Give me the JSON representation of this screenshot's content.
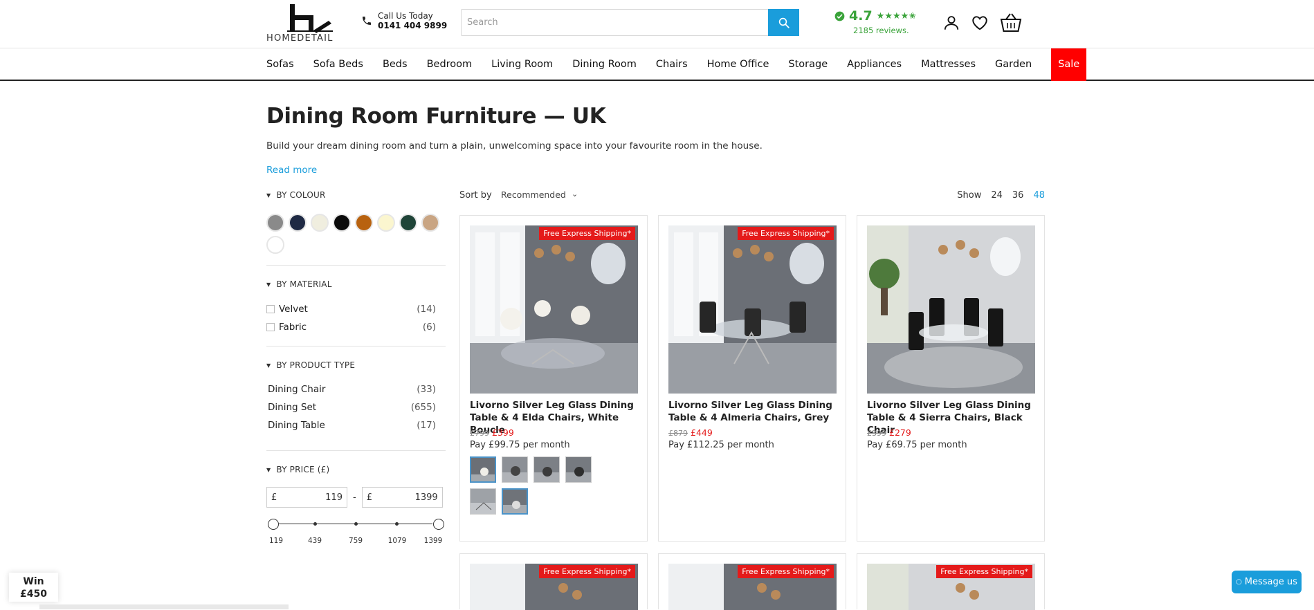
{
  "header": {
    "logo_text": "HOMEDETAIL",
    "call_label": "Call Us Today",
    "call_number": "0141 404 9899",
    "search_placeholder": "Search",
    "rating_score": "4.7",
    "rating_stars": "★★★★✬",
    "rating_reviews": "2185 reviews."
  },
  "nav": [
    "Sofas",
    "Sofa Beds",
    "Beds",
    "Bedroom",
    "Living Room",
    "Dining Room",
    "Chairs",
    "Home Office",
    "Storage",
    "Appliances",
    "Mattresses",
    "Garden",
    "Sale"
  ],
  "page": {
    "title": "Dining Room Furniture — UK",
    "description": "Build your dream dining room and turn a plain, unwelcoming space into your favourite room in the house.",
    "read_more": "Read more"
  },
  "filters": {
    "colour_title": "BY COLOUR",
    "colours": [
      "#8a8a8a",
      "#1f2a44",
      "#f0eedf",
      "#0b0b0b",
      "#b8620f",
      "#fbf6cf",
      "#1f4438",
      "#c9a583",
      "#ffffff"
    ],
    "material_title": "BY MATERIAL",
    "materials": [
      {
        "label": "Velvet",
        "count": "(14)"
      },
      {
        "label": "Fabric",
        "count": "(6)"
      }
    ],
    "product_type_title": "BY PRODUCT TYPE",
    "product_types": [
      {
        "label": "Dining Chair",
        "count": "(33)"
      },
      {
        "label": "Dining Set",
        "count": "(655)"
      },
      {
        "label": "Dining Table",
        "count": "(17)"
      }
    ],
    "price_title": "BY PRICE (£)",
    "currency": "£",
    "price_min": "119",
    "price_dash": "-",
    "price_max": "1399",
    "price_ticks": [
      "119",
      "439",
      "759",
      "1079",
      "1399"
    ]
  },
  "sort": {
    "label": "Sort by",
    "value": "Recommended",
    "show_label": "Show",
    "show_options": [
      "24",
      "36",
      "48"
    ],
    "show_selected": "48"
  },
  "badge_text": "Free Express Shipping*",
  "products": [
    {
      "title": "Livorno Silver Leg Glass Dining Table & 4 Elda Chairs, White Boucle",
      "old_price": "£799",
      "new_price": "£399",
      "monthly": "Pay £99.75 per month"
    },
    {
      "title": "Livorno Silver Leg Glass Dining Table & 4 Almeria Chairs, Grey",
      "old_price": "£879",
      "new_price": "£449",
      "monthly": "Pay £112.25 per month"
    },
    {
      "title": "Livorno Silver Leg Glass Dining Table & 4 Sierra Chairs, Black Chair",
      "old_price": "£399",
      "new_price": "£279",
      "monthly": "Pay £69.75 per month"
    }
  ],
  "widgets": {
    "win_line1": "Win",
    "win_line2": "£450",
    "message_label": "Message us"
  }
}
